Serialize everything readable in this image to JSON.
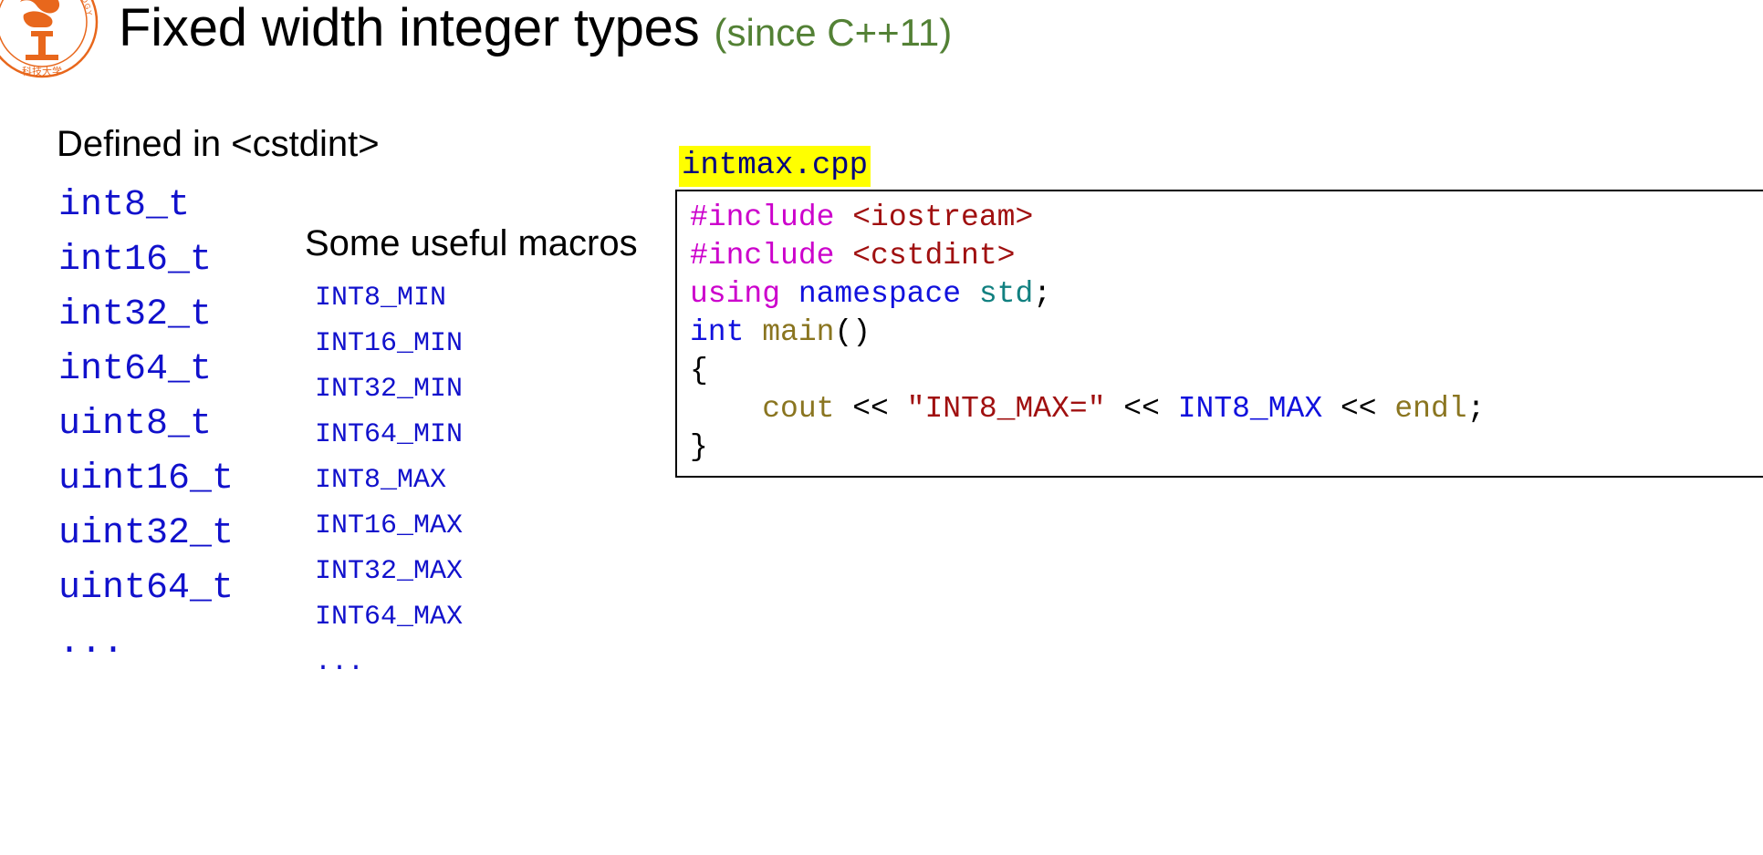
{
  "slide": {
    "title_main": "Fixed width integer types",
    "title_suffix": "(since C++11)",
    "title_suffix_color": "#538135",
    "code_color": "#1111cc",
    "highlight_color": "#ffff00"
  },
  "logo": {
    "name": "university-seal-logo",
    "outer_text": "TECHNOLOGY",
    "color": "#e8671c"
  },
  "left_column": {
    "heading": "Defined in <cstdint>",
    "items": [
      "int8_t",
      "int16_t",
      "int32_t",
      "int64_t",
      "uint8_t",
      "uint16_t",
      "uint32_t",
      "uint64_t",
      "..."
    ]
  },
  "middle_column": {
    "heading": "Some useful macros",
    "items": [
      "INT8_MIN",
      "INT16_MIN",
      "INT32_MIN",
      "INT64_MIN",
      "INT8_MAX",
      "INT16_MAX",
      "INT32_MAX",
      "INT64_MAX",
      "..."
    ]
  },
  "code_panel": {
    "filename": "intmax.cpp",
    "lines": [
      {
        "id": "line-1",
        "tokens": [
          {
            "t": "#include ",
            "c": "tok-pre"
          },
          {
            "t": "<iostream>",
            "c": "tok-hdr"
          }
        ]
      },
      {
        "id": "line-2",
        "tokens": [
          {
            "t": "#include ",
            "c": "tok-pre"
          },
          {
            "t": "<cstdint>",
            "c": "tok-hdr"
          }
        ]
      },
      {
        "id": "line-3",
        "tokens": [
          {
            "t": "using ",
            "c": "tok-pre"
          },
          {
            "t": "namespace ",
            "c": "tok-kw"
          },
          {
            "t": "std",
            "c": "tok-ns"
          },
          {
            "t": ";",
            "c": "tok-plain"
          }
        ]
      },
      {
        "id": "line-4",
        "tokens": [
          {
            "t": "int ",
            "c": "tok-kw"
          },
          {
            "t": "main",
            "c": "tok-fn"
          },
          {
            "t": "()",
            "c": "tok-plain"
          }
        ]
      },
      {
        "id": "line-5",
        "tokens": [
          {
            "t": "{",
            "c": "tok-plain"
          }
        ]
      },
      {
        "id": "line-6",
        "tokens": [
          {
            "t": "    cout",
            "c": "tok-id"
          },
          {
            "t": " << ",
            "c": "tok-plain"
          },
          {
            "t": "\"INT8_MAX=\"",
            "c": "tok-str"
          },
          {
            "t": " << ",
            "c": "tok-plain"
          },
          {
            "t": "INT8_MAX",
            "c": "tok-macro"
          },
          {
            "t": " << ",
            "c": "tok-plain"
          },
          {
            "t": "endl",
            "c": "tok-id"
          },
          {
            "t": ";",
            "c": "tok-plain"
          }
        ]
      },
      {
        "id": "line-7",
        "tokens": [
          {
            "t": "}",
            "c": "tok-plain"
          }
        ]
      }
    ]
  }
}
